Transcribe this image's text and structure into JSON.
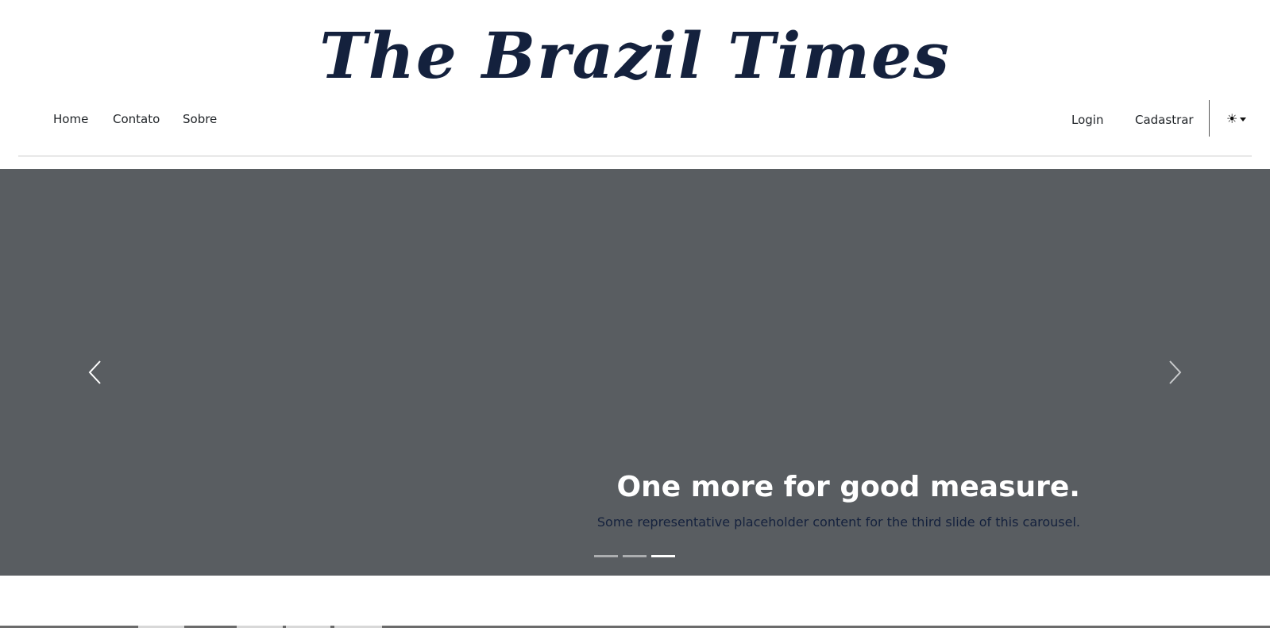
{
  "brand": {
    "title": "The Brazil Times"
  },
  "nav": {
    "left": [
      {
        "label": "Home"
      },
      {
        "label": "Contato"
      },
      {
        "label": "Sobre"
      }
    ],
    "right": [
      {
        "label": "Login"
      },
      {
        "label": "Cadastrar"
      }
    ],
    "theme_icon": "sun-icon"
  },
  "carousel": {
    "background": "#595d61",
    "caption_title": "One more for good measure.",
    "caption_text": "Some representative placeholder content for the third slide of this carousel.",
    "slide_count": 3,
    "active_slide": 3,
    "prev_icon": "chevron-left-icon",
    "next_icon": "chevron-right-icon"
  },
  "colors": {
    "brand": "#14213d",
    "caption_title": "#ffffff",
    "caption_text": "#14213d"
  }
}
